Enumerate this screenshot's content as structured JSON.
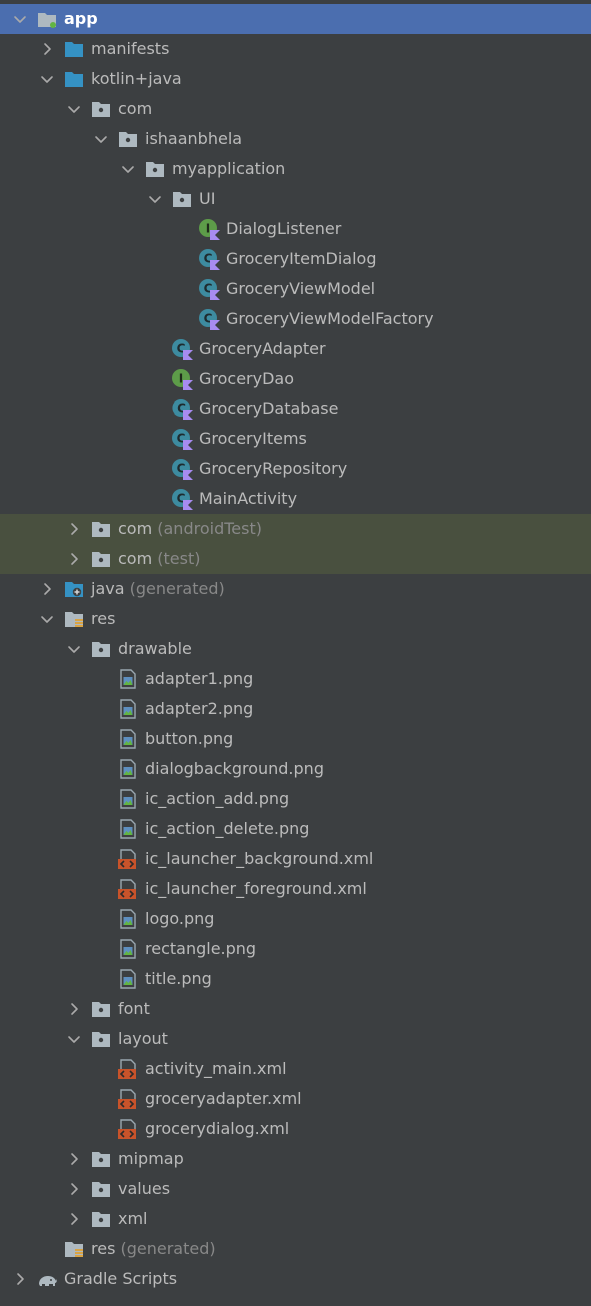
{
  "colors": {
    "background": "#3c3f41",
    "selection": "#4b6eaf",
    "test_sources_bg": "#49503f",
    "text": "#bbbbbb",
    "muted_text": "#888888",
    "folder_blue": "#3592c4",
    "package_gray": "#aeb9c0",
    "class_teal": "#3d8ba0",
    "interface_green": "#5d9c49",
    "kotlin_purple": "#a88bf0",
    "xml_orange": "#c8532a"
  },
  "tree": [
    {
      "label": "app",
      "suffix": "",
      "icon": "module-folder-icon",
      "chevron": "expanded",
      "depth": 0,
      "selected": true,
      "bold": true
    },
    {
      "label": "manifests",
      "suffix": "",
      "icon": "source-folder-icon",
      "chevron": "collapsed",
      "depth": 1
    },
    {
      "label": "kotlin+java",
      "suffix": "",
      "icon": "source-folder-icon",
      "chevron": "expanded",
      "depth": 1
    },
    {
      "label": "com",
      "suffix": "",
      "icon": "package-icon",
      "chevron": "expanded",
      "depth": 2
    },
    {
      "label": "ishaanbhela",
      "suffix": "",
      "icon": "package-icon",
      "chevron": "expanded",
      "depth": 3
    },
    {
      "label": "myapplication",
      "suffix": "",
      "icon": "package-icon",
      "chevron": "expanded",
      "depth": 4
    },
    {
      "label": "UI",
      "suffix": "",
      "icon": "package-icon",
      "chevron": "expanded",
      "depth": 5
    },
    {
      "label": "DialogListener",
      "suffix": "",
      "icon": "kotlin-interface-icon",
      "chevron": "none",
      "depth": 6
    },
    {
      "label": "GroceryItemDialog",
      "suffix": "",
      "icon": "kotlin-class-icon",
      "chevron": "none",
      "depth": 6
    },
    {
      "label": "GroceryViewModel",
      "suffix": "",
      "icon": "kotlin-class-icon",
      "chevron": "none",
      "depth": 6
    },
    {
      "label": "GroceryViewModelFactory",
      "suffix": "",
      "icon": "kotlin-class-icon",
      "chevron": "none",
      "depth": 6
    },
    {
      "label": "GroceryAdapter",
      "suffix": "",
      "icon": "kotlin-class-icon",
      "chevron": "none",
      "depth": 5
    },
    {
      "label": "GroceryDao",
      "suffix": "",
      "icon": "kotlin-interface-icon",
      "chevron": "none",
      "depth": 5
    },
    {
      "label": "GroceryDatabase",
      "suffix": "",
      "icon": "kotlin-abstract-class-icon",
      "chevron": "none",
      "depth": 5
    },
    {
      "label": "GroceryItems",
      "suffix": "",
      "icon": "kotlin-class-icon",
      "chevron": "none",
      "depth": 5
    },
    {
      "label": "GroceryRepository",
      "suffix": "",
      "icon": "kotlin-class-icon",
      "chevron": "none",
      "depth": 5
    },
    {
      "label": "MainActivity",
      "suffix": "",
      "icon": "kotlin-class-icon",
      "chevron": "none",
      "depth": 5
    },
    {
      "label": "com",
      "suffix": "(androidTest)",
      "icon": "package-icon",
      "chevron": "collapsed",
      "depth": 2,
      "test": true
    },
    {
      "label": "com",
      "suffix": "(test)",
      "icon": "package-icon",
      "chevron": "collapsed",
      "depth": 2,
      "test": true
    },
    {
      "label": "java",
      "suffix": "(generated)",
      "icon": "generated-folder-icon",
      "chevron": "collapsed",
      "depth": 1
    },
    {
      "label": "res",
      "suffix": "",
      "icon": "resource-folder-icon",
      "chevron": "expanded",
      "depth": 1
    },
    {
      "label": "drawable",
      "suffix": "",
      "icon": "package-icon",
      "chevron": "expanded",
      "depth": 2
    },
    {
      "label": "adapter1.png",
      "suffix": "",
      "icon": "image-file-icon",
      "chevron": "none",
      "depth": 3
    },
    {
      "label": "adapter2.png",
      "suffix": "",
      "icon": "image-file-icon",
      "chevron": "none",
      "depth": 3
    },
    {
      "label": "button.png",
      "suffix": "",
      "icon": "image-file-icon",
      "chevron": "none",
      "depth": 3
    },
    {
      "label": "dialogbackground.png",
      "suffix": "",
      "icon": "image-file-icon",
      "chevron": "none",
      "depth": 3
    },
    {
      "label": "ic_action_add.png",
      "suffix": "",
      "icon": "image-file-icon",
      "chevron": "none",
      "depth": 3
    },
    {
      "label": "ic_action_delete.png",
      "suffix": "",
      "icon": "image-file-icon",
      "chevron": "none",
      "depth": 3
    },
    {
      "label": "ic_launcher_background.xml",
      "suffix": "",
      "icon": "xml-file-icon",
      "chevron": "none",
      "depth": 3
    },
    {
      "label": "ic_launcher_foreground.xml",
      "suffix": "",
      "icon": "xml-file-icon",
      "chevron": "none",
      "depth": 3
    },
    {
      "label": "logo.png",
      "suffix": "",
      "icon": "image-file-icon",
      "chevron": "none",
      "depth": 3
    },
    {
      "label": "rectangle.png",
      "suffix": "",
      "icon": "image-file-icon",
      "chevron": "none",
      "depth": 3
    },
    {
      "label": "title.png",
      "suffix": "",
      "icon": "image-file-icon",
      "chevron": "none",
      "depth": 3
    },
    {
      "label": "font",
      "suffix": "",
      "icon": "package-icon",
      "chevron": "collapsed",
      "depth": 2
    },
    {
      "label": "layout",
      "suffix": "",
      "icon": "package-icon",
      "chevron": "expanded",
      "depth": 2
    },
    {
      "label": "activity_main.xml",
      "suffix": "",
      "icon": "xml-file-icon",
      "chevron": "none",
      "depth": 3
    },
    {
      "label": "groceryadapter.xml",
      "suffix": "",
      "icon": "xml-file-icon",
      "chevron": "none",
      "depth": 3
    },
    {
      "label": "grocerydialog.xml",
      "suffix": "",
      "icon": "xml-file-icon",
      "chevron": "none",
      "depth": 3
    },
    {
      "label": "mipmap",
      "suffix": "",
      "icon": "package-icon",
      "chevron": "collapsed",
      "depth": 2
    },
    {
      "label": "values",
      "suffix": "",
      "icon": "package-icon",
      "chevron": "collapsed",
      "depth": 2
    },
    {
      "label": "xml",
      "suffix": "",
      "icon": "package-icon",
      "chevron": "collapsed",
      "depth": 2
    },
    {
      "label": "res",
      "suffix": "(generated)",
      "icon": "resource-folder-icon",
      "chevron": "none",
      "depth": 1
    },
    {
      "label": "Gradle Scripts",
      "suffix": "",
      "icon": "gradle-elephant-icon",
      "chevron": "collapsed",
      "depth": 0
    }
  ]
}
